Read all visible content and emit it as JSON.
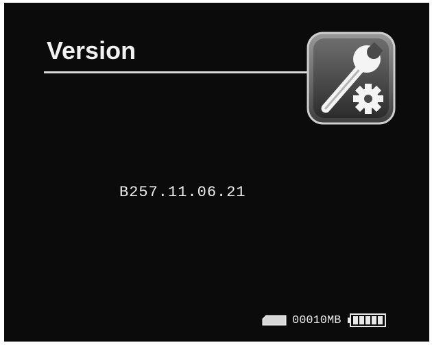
{
  "header": {
    "title": "Version",
    "icon": "wrench-gear-settings-icon"
  },
  "main": {
    "version": "B257.11.06.21"
  },
  "status_bar": {
    "storage_icon": "sd-card-icon",
    "storage": "00010MB",
    "battery_icon": "battery-icon",
    "battery_level": 1.0
  },
  "colors": {
    "background": "#0b0b0b",
    "text": "#f2f2f2",
    "icon_frame": "#5a5a5a"
  }
}
